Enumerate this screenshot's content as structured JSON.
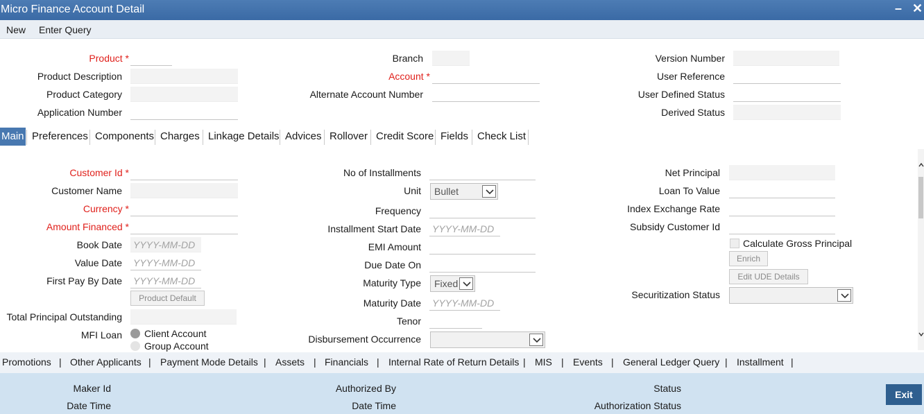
{
  "window": {
    "title": "Micro Finance Account Detail",
    "minimize_icon": "minus-icon",
    "close_icon": "close-icon"
  },
  "menu": {
    "new": "New",
    "enter_query": "Enter Query"
  },
  "header": {
    "product_label": "Product",
    "product_description_label": "Product Description",
    "product_category_label": "Product Category",
    "application_number_label": "Application Number",
    "branch_label": "Branch",
    "account_label": "Account",
    "alternate_account_label": "Alternate Account Number",
    "version_number_label": "Version Number",
    "user_reference_label": "User Reference",
    "user_defined_status_label": "User Defined Status",
    "derived_status_label": "Derived Status",
    "required_marker": "*"
  },
  "tabs": [
    "Main",
    "Preferences",
    "Components",
    "Charges",
    "Linkage Details",
    "Advices",
    "Rollover",
    "Credit Score",
    "Fields",
    "Check List"
  ],
  "main": {
    "customer_id_label": "Customer Id",
    "customer_name_label": "Customer Name",
    "currency_label": "Currency",
    "amount_financed_label": "Amount Financed",
    "book_date_label": "Book Date",
    "value_date_label": "Value Date",
    "first_pay_by_date_label": "First Pay By Date",
    "date_placeholder": "YYYY-MM-DD",
    "product_default_button": "Product Default",
    "total_principal_outstanding_label": "Total Principal Outstanding",
    "mfi_loan_label": "MFI Loan",
    "client_account_option": "Client Account",
    "group_account_option": "Group Account",
    "no_of_installments_label": "No of Installments",
    "unit_label": "Unit",
    "unit_value": "Bullet",
    "frequency_label": "Frequency",
    "installment_start_date_label": "Installment Start Date",
    "emi_amount_label": "EMI Amount",
    "due_date_on_label": "Due Date On",
    "maturity_type_label": "Maturity Type",
    "maturity_type_value": "Fixed",
    "maturity_date_label": "Maturity Date",
    "tenor_label": "Tenor",
    "disbursement_occurrence_label": "Disbursement Occurrence",
    "net_principal_label": "Net Principal",
    "loan_to_value_label": "Loan To Value",
    "index_exchange_rate_label": "Index Exchange Rate",
    "subsidy_customer_id_label": "Subsidy Customer Id",
    "calculate_gross_principal_label": "Calculate Gross Principal",
    "enrich_button": "Enrich",
    "edit_ude_details_button": "Edit UDE Details",
    "securitization_status_label": "Securitization Status"
  },
  "links": [
    "Promotions",
    "|",
    "Other Applicants",
    "|",
    "Payment Mode Details",
    "|",
    "Assets",
    "|",
    "Financials",
    "|",
    "Internal Rate of Return Details",
    "|",
    "MIS",
    "|",
    "Events",
    "|",
    "General Ledger Query",
    "|",
    "Installment",
    "|"
  ],
  "footer": {
    "maker_id_label": "Maker Id",
    "date_time_label": "Date Time",
    "authorized_by_label": "Authorized By",
    "date_time_label_2": "Date Time",
    "status_label": "Status",
    "authorization_status_label": "Authorization Status",
    "exit_button": "Exit"
  },
  "colors": {
    "titlebar": "#3a6aa5",
    "required": "#e0201b",
    "active_tab": "#4878b0",
    "footer": "#d0e2f1",
    "exit_button": "#2f5f8f"
  }
}
